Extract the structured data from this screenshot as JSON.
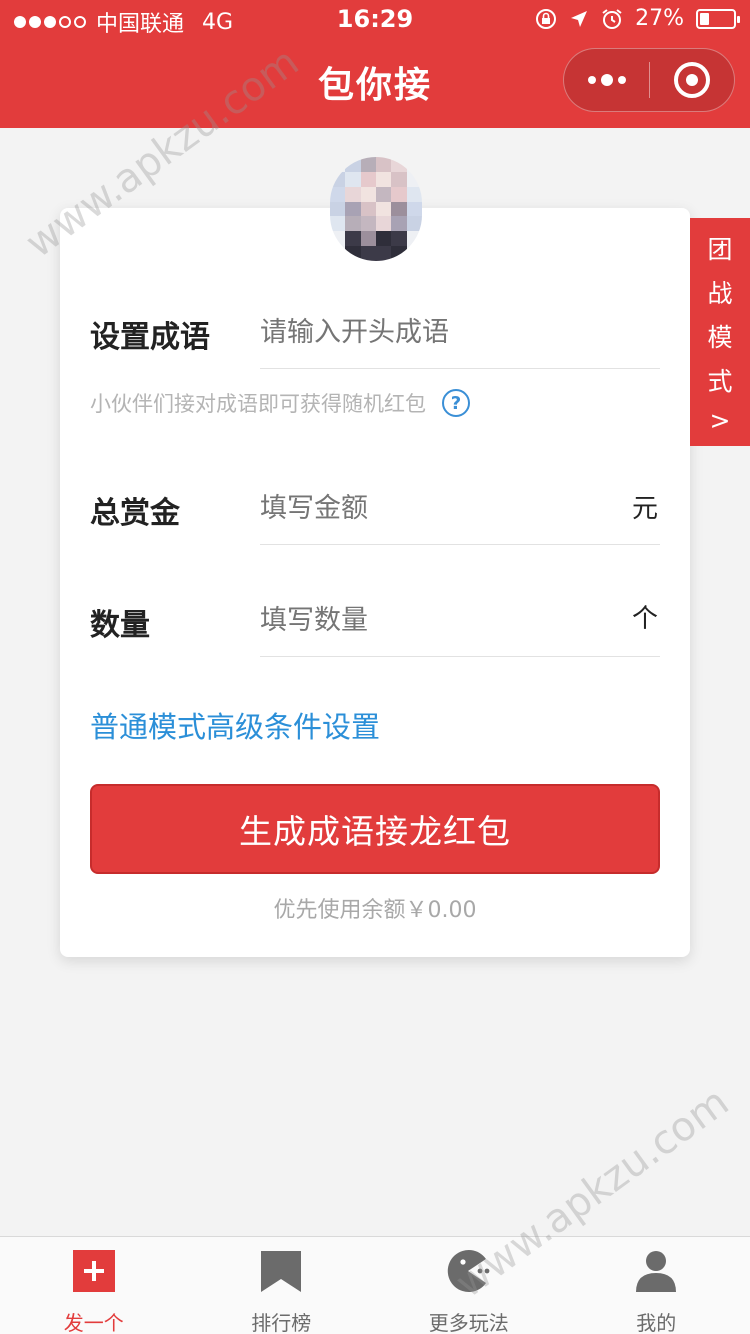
{
  "status_bar": {
    "carrier": "中国联通",
    "network": "4G",
    "time": "16:29",
    "battery_percent": "27%",
    "battery_level": 0.27
  },
  "nav": {
    "title": "包你接",
    "more_icon": "more-dots-icon",
    "close_icon": "target-close-icon"
  },
  "form": {
    "idiom": {
      "label": "设置成语",
      "placeholder": "请输入开头成语"
    },
    "hint": "小伙伴们接对成语即可获得随机红包",
    "help_symbol": "?",
    "amount": {
      "label": "总赏金",
      "placeholder": "填写金额",
      "unit": "元"
    },
    "count": {
      "label": "数量",
      "placeholder": "填写数量",
      "unit": "个"
    },
    "advanced_link": "普通模式高级条件设置",
    "submit_label": "生成成语接龙红包",
    "balance_text": "优先使用余额￥0.00"
  },
  "side_tab": {
    "chars": [
      "团",
      "战",
      "模",
      "式",
      ">"
    ]
  },
  "watermark": "www.apkzu.com",
  "tabbar": {
    "items": [
      {
        "label": "发一个",
        "icon": "plus-square-icon",
        "active": true
      },
      {
        "label": "排行榜",
        "icon": "bookmark-icon",
        "active": false
      },
      {
        "label": "更多玩法",
        "icon": "pacman-game-icon",
        "active": false
      },
      {
        "label": "我的",
        "icon": "user-profile-icon",
        "active": false
      }
    ]
  },
  "colors": {
    "brand_red": "#e23c3c",
    "link_blue": "#2b8fd8",
    "placeholder_gray": "#9a9a9a",
    "tab_gray": "#6b6b6b"
  }
}
